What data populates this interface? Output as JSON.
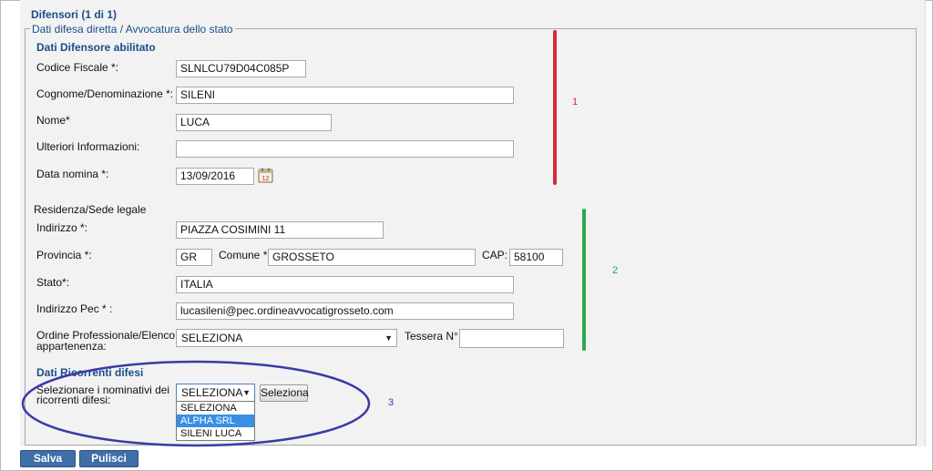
{
  "header": {
    "title": "Difensori (1 di 1)"
  },
  "fieldset_legend": "Dati difesa diretta / Avvocatura dello stato",
  "difensore": {
    "heading": "Dati Difensore abilitato",
    "codice_fiscale": {
      "label": "Codice Fiscale *:",
      "value": "SLNLCU79D04C085P"
    },
    "cognome": {
      "label": "Cognome/Denominazione *:",
      "value": "SILENI"
    },
    "nome": {
      "label": "Nome*",
      "value": "LUCA"
    },
    "ulteriori": {
      "label": "Ulteriori Informazioni:",
      "value": ""
    },
    "data_nomina": {
      "label": "Data nomina *:",
      "value": "13/09/2016",
      "calendar_icon_text": "12"
    }
  },
  "residenza": {
    "heading": "Residenza/Sede legale",
    "indirizzo": {
      "label": "Indirizzo *:",
      "value": "PIAZZA COSIMINI 11"
    },
    "provincia": {
      "label": "Provincia *:",
      "value": "GR"
    },
    "comune": {
      "label": "Comune *:",
      "value": "GROSSETO"
    },
    "cap": {
      "label": "CAP:",
      "value": "58100"
    },
    "stato": {
      "label": "Stato*:",
      "value": "ITALIA"
    },
    "pec": {
      "label": "Indirizzo Pec * :",
      "value": "lucasileni@pec.ordineavvocatigrosseto.com"
    },
    "ordine": {
      "label_line1": "Ordine Professionale/Elenco di",
      "label_line2": "appartenenza:",
      "value": "SELEZIONA"
    },
    "tessera": {
      "label": "Tessera N°:",
      "value": ""
    }
  },
  "ricorrenti": {
    "heading": "Dati Ricorrenti difesi",
    "label_line1": "Selezionare i nominativi dei",
    "label_line2": "ricorrenti difesi:",
    "select_value": "SELEZIONA",
    "button_label": "Seleziona",
    "options": [
      "SELEZIONA",
      "ALPHA SRL",
      "SILENI LUCA"
    ],
    "highlighted_index": 1
  },
  "actions": {
    "save_label": "Salva",
    "clear_label": "Pulisci"
  },
  "annotations": {
    "one": {
      "label": "1",
      "color": "#d7263d"
    },
    "two": {
      "label": "2",
      "color": "#2ea84a"
    },
    "three": {
      "label": "3",
      "color": "#3a3aa8"
    }
  },
  "colors": {
    "accent": "#1a4e8a",
    "primary_button": "#3f6ea8",
    "highlight": "#3a8ee6"
  }
}
